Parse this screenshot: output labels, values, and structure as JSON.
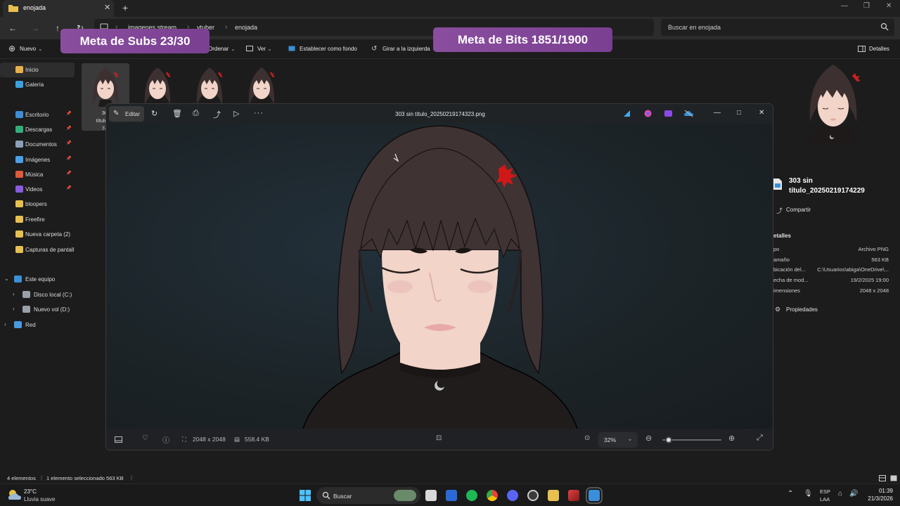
{
  "window": {
    "tab_title": "enojada",
    "tab_close": "✕",
    "new_tab": "+"
  },
  "address": {
    "crumbs": [
      "imagenes stream",
      "vtuber",
      "enojada"
    ],
    "search_placeholder": "Buscar en enojada"
  },
  "commands": {
    "new": "Nuevo",
    "sort": "Ordenar",
    "view": "Ver",
    "set_background": "Establecer como fondo",
    "rotate_left": "Girar a la izquierda",
    "details": "Detalles"
  },
  "overlays": {
    "subs": "Meta de Subs  23/30",
    "bits": "Meta de Bits  1851/1900"
  },
  "sidebar": {
    "items": [
      {
        "label": "Inicio",
        "color": "#e8b04a",
        "pinned": false
      },
      {
        "label": "Galería",
        "color": "#3aa0e0",
        "pinned": false
      },
      {
        "label": "Escritorio",
        "color": "#3a8fd8",
        "pinned": true
      },
      {
        "label": "Descargas",
        "color": "#2fb07a",
        "pinned": true
      },
      {
        "label": "Documentos",
        "color": "#8aa0b8",
        "pinned": true
      },
      {
        "label": "Imágenes",
        "color": "#4aa0e8",
        "pinned": true
      },
      {
        "label": "Música",
        "color": "#e05a3a",
        "pinned": true
      },
      {
        "label": "Videos",
        "color": "#8a5ae0",
        "pinned": true
      },
      {
        "label": "bloopers",
        "color": "#e8c050",
        "pinned": false
      },
      {
        "label": "Freefire",
        "color": "#e8c050",
        "pinned": false
      },
      {
        "label": "Nueva carpeta (2)",
        "color": "#e8c050",
        "pinned": false
      },
      {
        "label": "Capturas de pantall",
        "color": "#e8c050",
        "pinned": false
      }
    ],
    "tree": [
      {
        "label": "Este equipo",
        "expanded": true
      },
      {
        "label": "Disco local (C:)",
        "expanded": false
      },
      {
        "label": "Nuevo vol (D:)",
        "expanded": false
      },
      {
        "label": "Red",
        "expanded": false
      }
    ],
    "pin_glyph": "📌"
  },
  "thumbnail_caption": [
    "303",
    "título_20",
    "742"
  ],
  "viewer": {
    "title": "303 sin título_20250219174323.png",
    "edit": "Editar",
    "dimensions": "2048 x 2048",
    "filesize": "558.4 KB",
    "zoom": "32%",
    "zoom_level": 0.05
  },
  "details": {
    "filename": "303 sin título_20250219174229",
    "share": "Compartir",
    "section": "etalles",
    "rows": [
      {
        "key": "po",
        "value": "Archivo PNG"
      },
      {
        "key": "amaño",
        "value": "563 KB"
      },
      {
        "key": "bicación del...",
        "value": "C:\\Usuarios\\abiga\\OneDrive\\..."
      },
      {
        "key": "echa de mod...",
        "value": "19/2/2025 19:00"
      },
      {
        "key": "imensiones",
        "value": "2048 x 2048"
      }
    ],
    "properties": "Propiedades"
  },
  "status": {
    "count": "4 elementos",
    "selection": "1 elemento seleccionado  563 KB"
  },
  "taskbar": {
    "weather_temp": "23°C",
    "weather_desc": "Lluvia suave",
    "search": "Buscar",
    "lang1": "ESP",
    "lang2": "LAA",
    "time": "01:39",
    "date": "21/3/2026"
  }
}
